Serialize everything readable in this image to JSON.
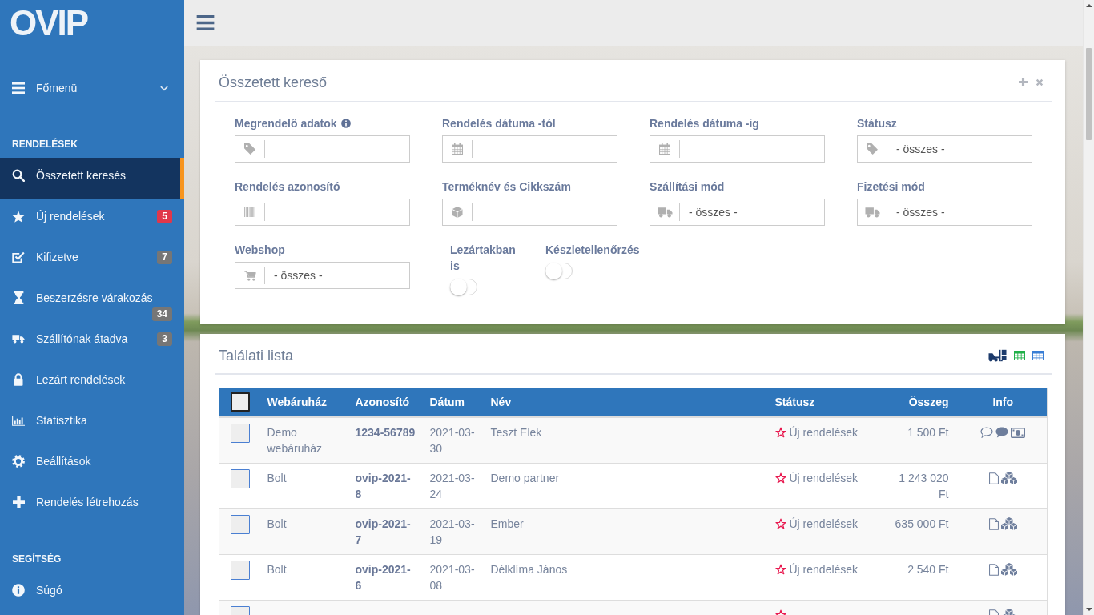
{
  "sidebar": {
    "logo": "OVIP",
    "main_menu": {
      "label": "Főmenü",
      "expanded": false
    },
    "sections": [
      {
        "title": "RENDELÉSEK",
        "items": [
          {
            "label": "Összetett keresés",
            "selected": true
          },
          {
            "label": "Új rendelések",
            "selected": false,
            "badge": {
              "text": "5",
              "color": "#e0374b"
            }
          },
          {
            "label": "Kifizetve",
            "selected": false,
            "badge": {
              "text": "7",
              "color": "#767676"
            }
          },
          {
            "label": "Beszerzésre várakozás",
            "selected": false,
            "badge": {
              "text": "34",
              "color": "#767676"
            }
          },
          {
            "label": "Szállítónak átadva",
            "selected": false,
            "badge": {
              "text": "3",
              "color": "#767676"
            }
          },
          {
            "label": "Lezárt rendelések",
            "selected": false
          },
          {
            "label": "Statisztika",
            "selected": false
          },
          {
            "label": "Beállítások",
            "selected": false
          },
          {
            "label": "Rendelés létrehozás",
            "selected": false
          }
        ]
      },
      {
        "title": "SEGÍTSÉG",
        "items": [
          {
            "label": "Súgó",
            "selected": false
          }
        ]
      }
    ]
  },
  "search_panel": {
    "title": "Összetett kereső",
    "fields": [
      {
        "label": "Megrendelő adatok",
        "info": true,
        "kind": "text"
      },
      {
        "label": "Rendelés dátuma -tól",
        "info": false,
        "kind": "text"
      },
      {
        "label": "Rendelés dátuma -ig",
        "info": false,
        "kind": "text"
      },
      {
        "label": "Státusz",
        "info": false,
        "kind": "select",
        "value": "- összes -"
      },
      {
        "label": "Rendelés azonosító",
        "info": false,
        "kind": "text"
      },
      {
        "label": "Terméknév és Cikkszám",
        "info": false,
        "kind": "text"
      },
      {
        "label": "Szállítási mód",
        "info": false,
        "kind": "select",
        "value": "- összes -"
      },
      {
        "label": "Fizetési mód",
        "info": false,
        "kind": "select",
        "value": "- összes -"
      },
      {
        "label": "Webshop",
        "info": false,
        "kind": "select",
        "value": "- összes -"
      }
    ],
    "toggles": [
      {
        "label": "Lezártakban is",
        "on": false
      },
      {
        "label": "Készletellenőrzés",
        "on": false
      }
    ]
  },
  "results": {
    "title": "Találati lista",
    "table": {
      "all_checked": false,
      "columns": [
        "Webáruház",
        "Azonosító",
        "Dátum",
        "Név",
        "Státusz",
        "Összeg",
        "Info"
      ],
      "rows": [
        {
          "checked": false,
          "webshop": "Demo webáruház",
          "id": "1234-56789",
          "date": "2021-03-30",
          "name": "Teszt Elek",
          "status": "Új rendelések",
          "total": "1 500 Ft",
          "info": [
            {
              "kind": "note"
            },
            {
              "kind": "message"
            },
            {
              "kind": "payment"
            }
          ]
        },
        {
          "checked": false,
          "webshop": "Bolt",
          "id": "ovip-2021-8",
          "date": "2021-03-24",
          "name": "Demo partner",
          "status": "Új rendelések",
          "total": "1 243 020 Ft",
          "info": [
            {
              "kind": "document"
            },
            {
              "kind": "stock"
            }
          ]
        },
        {
          "checked": false,
          "webshop": "Bolt",
          "id": "ovip-2021-7",
          "date": "2021-03-19",
          "name": "Ember",
          "status": "Új rendelések",
          "total": "635 000 Ft",
          "info": [
            {
              "kind": "document"
            },
            {
              "kind": "stock"
            }
          ]
        },
        {
          "checked": false,
          "webshop": "Bolt",
          "id": "ovip-2021-6",
          "date": "2021-03-08",
          "name": "Délklíma János",
          "status": "Új rendelések",
          "total": "2 540 Ft",
          "info": [
            {
              "kind": "document"
            },
            {
              "kind": "stock"
            }
          ]
        },
        {
          "checked": false,
          "info": [
            {
              "kind": "document"
            },
            {
              "kind": "stock"
            }
          ]
        }
      ]
    }
  }
}
